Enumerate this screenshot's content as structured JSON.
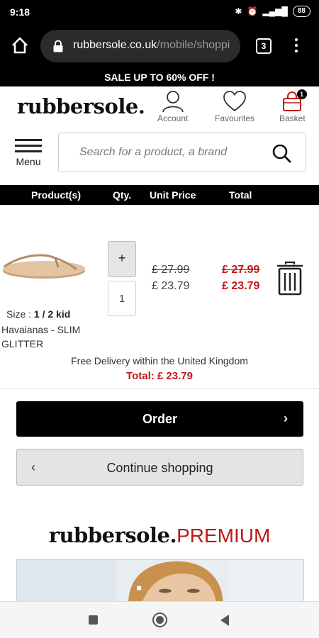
{
  "status_bar": {
    "time": "9:18",
    "battery": "88"
  },
  "browser": {
    "url_domain": "rubbersole.co.uk",
    "url_path": "/mobile/shoppi",
    "tab_count": "3"
  },
  "sale_banner": "SALE UP TO 60% OFF !",
  "header": {
    "logo": "rubbersole.",
    "account_label": "Account",
    "favourites_label": "Favourites",
    "basket_label": "Basket",
    "basket_count": "1"
  },
  "menu_label": "Menu",
  "search": {
    "placeholder": "Search for a product, a brand"
  },
  "cart_table": {
    "headers": {
      "product": "Product(s)",
      "qty": "Qty.",
      "unit_price": "Unit Price",
      "total": "Total"
    }
  },
  "item": {
    "size_label": "Size :",
    "size_value": "1 / 2 kid",
    "name": "Havaianas - SLIM GLITTER",
    "qty_plus": "+",
    "quantity": "1",
    "unit_price_old": "£ 27.99",
    "unit_price_new": "£ 23.79",
    "total_old": "£ 27.99",
    "total_new": "£ 23.79"
  },
  "delivery_note": "Free Delivery within the United Kingdom",
  "grand_total": "Total: £ 23.79",
  "buttons": {
    "order": "Order",
    "order_chevron": "›",
    "continue": "Continue shopping",
    "continue_chevron": "‹"
  },
  "premium_logo": {
    "main": "rubbersole.",
    "suffix": "PREMIUM"
  },
  "colors": {
    "accent_red": "#c01818",
    "black": "#000000"
  },
  "icons": [
    "home-icon",
    "lock-icon",
    "tabs-icon",
    "more-icon",
    "account-icon",
    "heart-icon",
    "basket-icon",
    "menu-icon",
    "search-icon",
    "trash-icon"
  ]
}
